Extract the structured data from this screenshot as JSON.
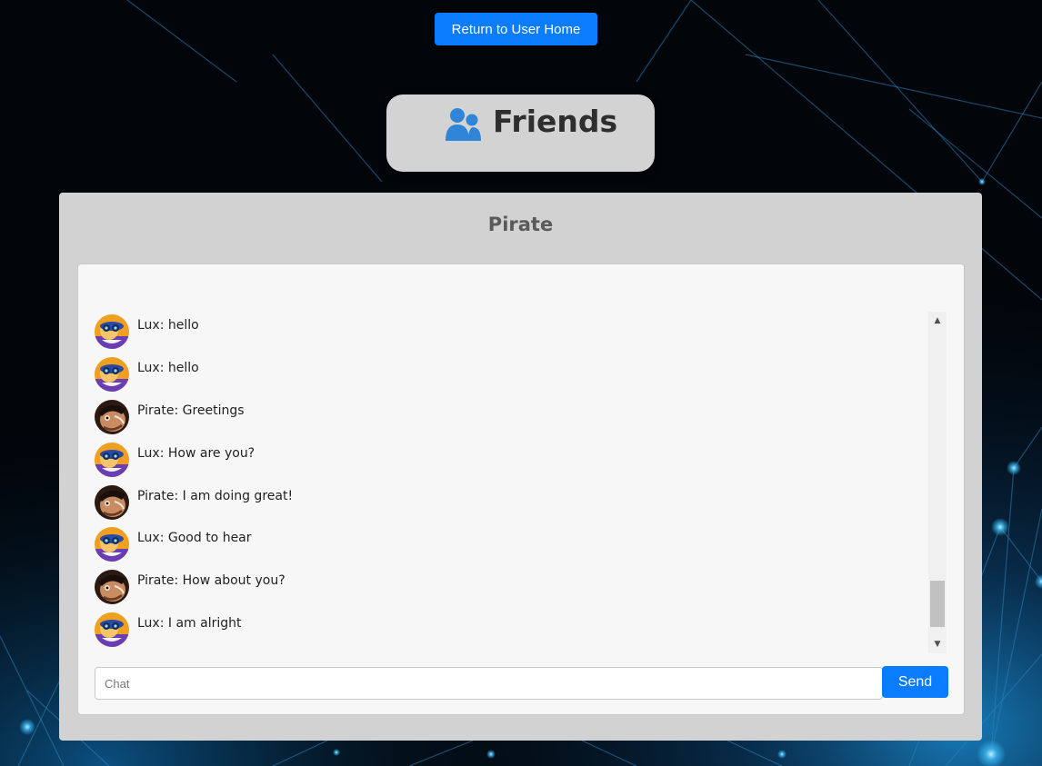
{
  "nav": {
    "home_button_label": "Return to User Home"
  },
  "header": {
    "title": "Friends",
    "icon": "users-icon"
  },
  "chat": {
    "friend_name": "Pirate",
    "messages": [
      {
        "avatar": "lux-avatar",
        "text": "Lux: hello"
      },
      {
        "avatar": "lux-avatar",
        "text": "Lux: hello"
      },
      {
        "avatar": "pirate-avatar",
        "text": "Pirate: Greetings"
      },
      {
        "avatar": "lux-avatar",
        "text": "Lux: How are you?"
      },
      {
        "avatar": "pirate-avatar",
        "text": "Pirate: I am doing great!"
      },
      {
        "avatar": "lux-avatar",
        "text": "Lux: Good to hear"
      },
      {
        "avatar": "pirate-avatar",
        "text": "Pirate: How about you?"
      },
      {
        "avatar": "lux-avatar",
        "text": "Lux: I am alright"
      }
    ],
    "input_placeholder": "Chat",
    "input_value": "",
    "send_label": "Send"
  },
  "colors": {
    "accent": "#0a7cff",
    "panel": "#d2d2d2",
    "card": "#f7f7f7",
    "background": "#02060b"
  }
}
